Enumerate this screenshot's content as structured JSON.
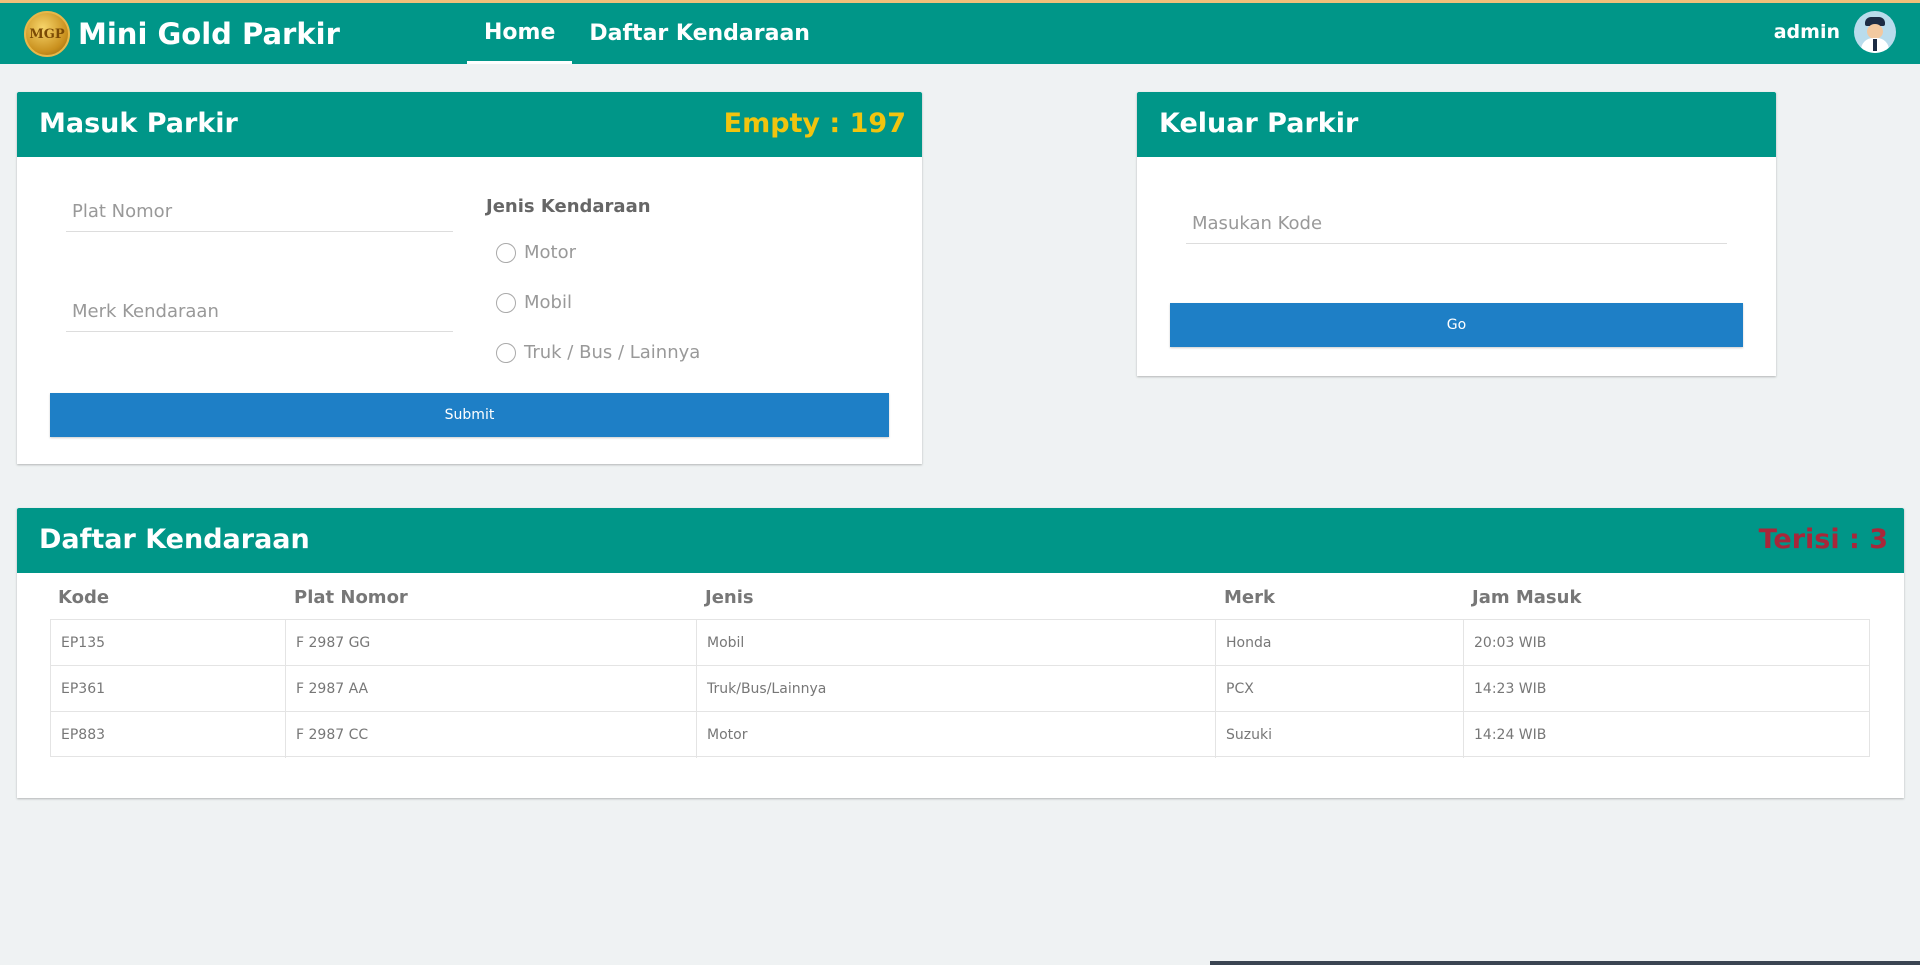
{
  "app": {
    "title": "Mini Gold Parkir",
    "logo_text": "MGP"
  },
  "nav": {
    "items": [
      {
        "label": "Home",
        "active": true
      },
      {
        "label": "Daftar Kendaraan",
        "active": false
      }
    ]
  },
  "user": {
    "name": "admin"
  },
  "masuk": {
    "title": "Masuk Parkir",
    "count_label": "Empty : 197",
    "count_color": "#f1c40f",
    "plat_placeholder": "Plat Nomor",
    "merk_placeholder": "Merk Kendaraan",
    "jenis_title": "Jenis Kendaraan",
    "options": [
      "Motor",
      "Mobil",
      "Truk / Bus / Lainnya"
    ],
    "submit_label": "Submit"
  },
  "keluar": {
    "title": "Keluar Parkir",
    "kode_placeholder": "Masukan Kode",
    "go_label": "Go"
  },
  "daftar": {
    "title": "Daftar Kendaraan",
    "count_label": "Terisi : 3",
    "count_color": "#a8273a",
    "columns": [
      "Kode",
      "Plat Nomor",
      "Jenis",
      "Merk",
      "Jam Masuk"
    ],
    "rows": [
      [
        "EP135",
        "F 2987 GG",
        "Mobil",
        "Honda",
        "20:03 WIB"
      ],
      [
        "EP361",
        "F 2987 AA",
        "Truk/Bus/Lainnya",
        "PCX",
        "14:23 WIB"
      ],
      [
        "EP883",
        "F 2987 CC",
        "Motor",
        "Suzuki",
        "14:24 WIB"
      ]
    ]
  },
  "colors": {
    "primary": "#009688",
    "button": "#1e7fc6",
    "background": "#eff2f3"
  }
}
